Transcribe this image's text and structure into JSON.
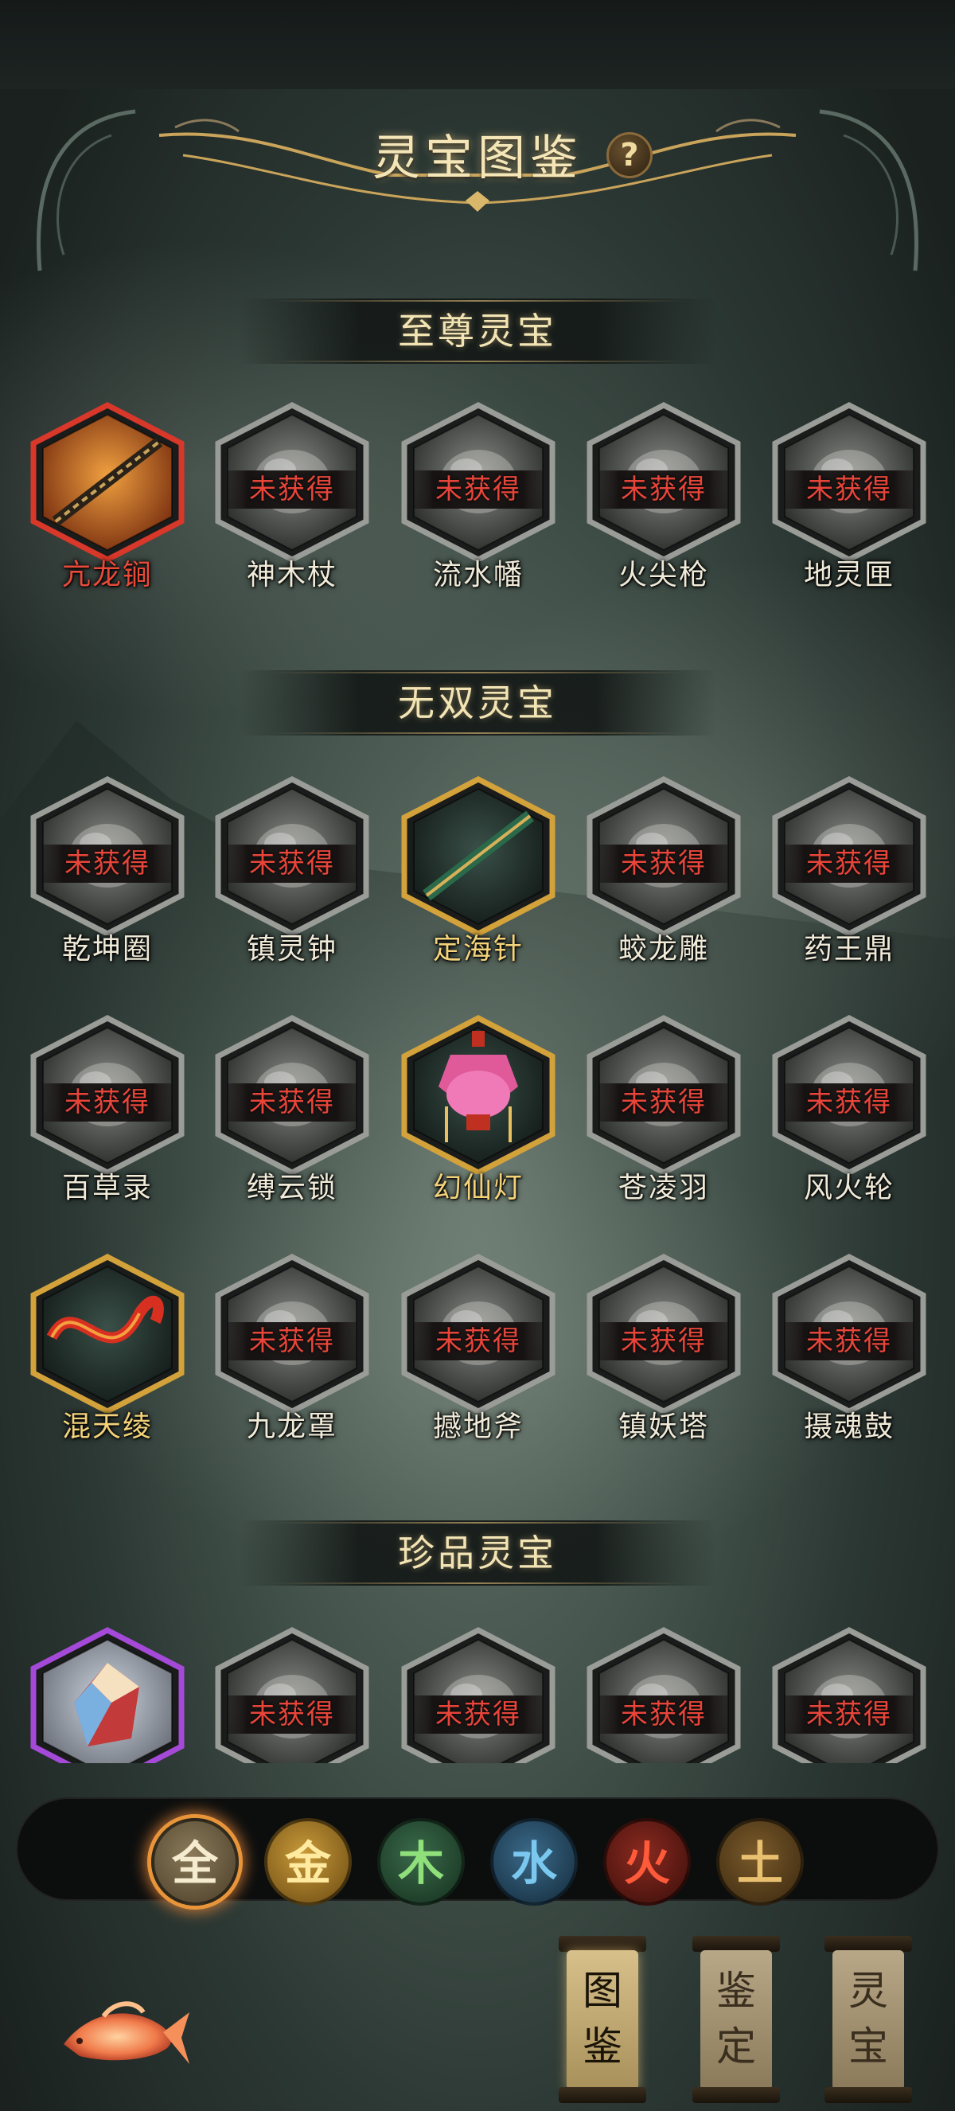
{
  "header": {
    "title": "灵宝图鉴",
    "help_label": "?"
  },
  "locked_label": "未获得",
  "sections": [
    {
      "title": "至尊灵宝",
      "items": [
        {
          "name": "亢龙锏",
          "status": "obtained",
          "frame": "red"
        },
        {
          "name": "神木杖",
          "status": "locked",
          "frame": "gray"
        },
        {
          "name": "流水幡",
          "status": "locked",
          "frame": "gray"
        },
        {
          "name": "火尖枪",
          "status": "locked",
          "frame": "gray"
        },
        {
          "name": "地灵匣",
          "status": "locked",
          "frame": "gray"
        }
      ]
    },
    {
      "title": "无双灵宝",
      "items": [
        {
          "name": "乾坤圈",
          "status": "locked",
          "frame": "gray"
        },
        {
          "name": "镇灵钟",
          "status": "locked",
          "frame": "gray"
        },
        {
          "name": "定海针",
          "status": "obtained",
          "frame": "gold"
        },
        {
          "name": "蛟龙雕",
          "status": "locked",
          "frame": "gray"
        },
        {
          "name": "药王鼎",
          "status": "locked",
          "frame": "gray"
        },
        {
          "name": "百草录",
          "status": "locked",
          "frame": "gray"
        },
        {
          "name": "缚云锁",
          "status": "locked",
          "frame": "gray"
        },
        {
          "name": "幻仙灯",
          "status": "obtained",
          "frame": "gold"
        },
        {
          "name": "苍凌羽",
          "status": "locked",
          "frame": "gray"
        },
        {
          "name": "风火轮",
          "status": "locked",
          "frame": "gray"
        },
        {
          "name": "混天绫",
          "status": "obtained",
          "frame": "gold"
        },
        {
          "name": "九龙罩",
          "status": "locked",
          "frame": "gray"
        },
        {
          "name": "撼地斧",
          "status": "locked",
          "frame": "gray"
        },
        {
          "name": "镇妖塔",
          "status": "locked",
          "frame": "gray"
        },
        {
          "name": "摄魂鼓",
          "status": "locked",
          "frame": "gray"
        }
      ]
    },
    {
      "title": "珍品灵宝",
      "items": [
        {
          "name": "",
          "status": "obtained",
          "frame": "purple"
        },
        {
          "name": "",
          "status": "locked",
          "frame": "gray"
        },
        {
          "name": "",
          "status": "locked",
          "frame": "gray"
        },
        {
          "name": "",
          "status": "locked",
          "frame": "gray"
        },
        {
          "name": "",
          "status": "locked",
          "frame": "gray"
        }
      ]
    }
  ],
  "filters": [
    {
      "label": "全",
      "key": "all",
      "selected": true
    },
    {
      "label": "金",
      "key": "metal",
      "selected": false
    },
    {
      "label": "木",
      "key": "wood",
      "selected": false
    },
    {
      "label": "水",
      "key": "water",
      "selected": false
    },
    {
      "label": "火",
      "key": "fire",
      "selected": false
    },
    {
      "label": "土",
      "key": "earth",
      "selected": false
    }
  ],
  "bottom_tabs": [
    {
      "label_top": "图",
      "label_bottom": "鉴",
      "selected": true
    },
    {
      "label_top": "鉴",
      "label_bottom": "定",
      "selected": false
    },
    {
      "label_top": "灵",
      "label_bottom": "宝",
      "selected": false
    }
  ],
  "colors": {
    "frame_red": "#d8382a",
    "frame_gold": "#d4a23a",
    "frame_gray": "#9a9c98",
    "frame_purple": "#a54ad8",
    "locked_text": "#e8453a",
    "accent_orange": "#e8953a"
  },
  "icons": {
    "help": "question-mark-icon",
    "koi": "koi-fish-icon"
  }
}
